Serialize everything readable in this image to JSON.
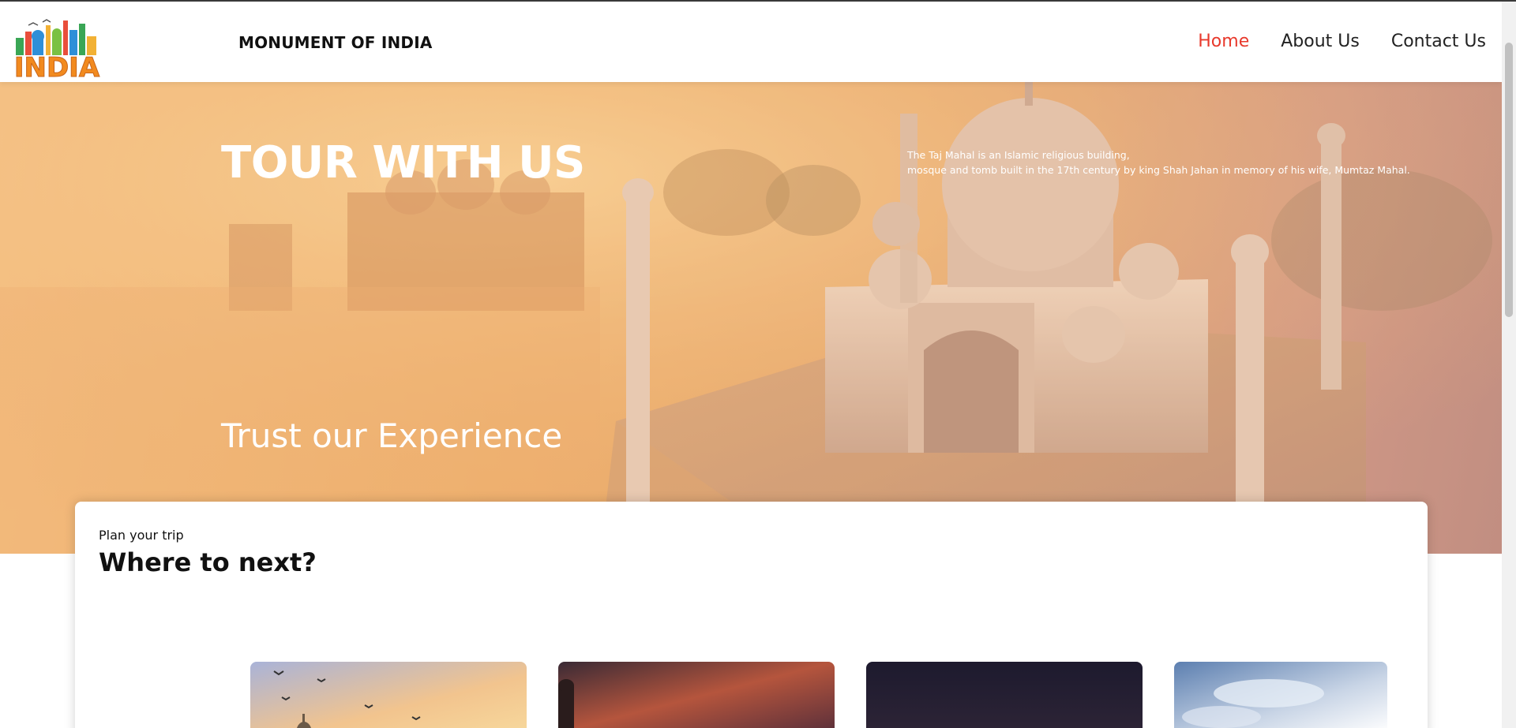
{
  "navbar": {
    "brand": "MONUMENT OF INDIA",
    "logo_text": "INDIA",
    "links": [
      {
        "label": "Home",
        "active": true
      },
      {
        "label": "About Us",
        "active": false
      },
      {
        "label": "Contact Us",
        "active": false
      }
    ]
  },
  "hero": {
    "title": "TOUR WITH US",
    "description_line1": "The Taj Mahal is an Islamic religious building,",
    "description_line2": "mosque and tomb built in the 17th century by king Shah Jahan in memory of his wife, Mumtaz Mahal.",
    "subtitle": "Trust our Experience"
  },
  "plan": {
    "kicker": "Plan your trip",
    "title": "Where to next?"
  },
  "colors": {
    "accent": "#e8392c",
    "hero_tint": "#eeb06a"
  }
}
